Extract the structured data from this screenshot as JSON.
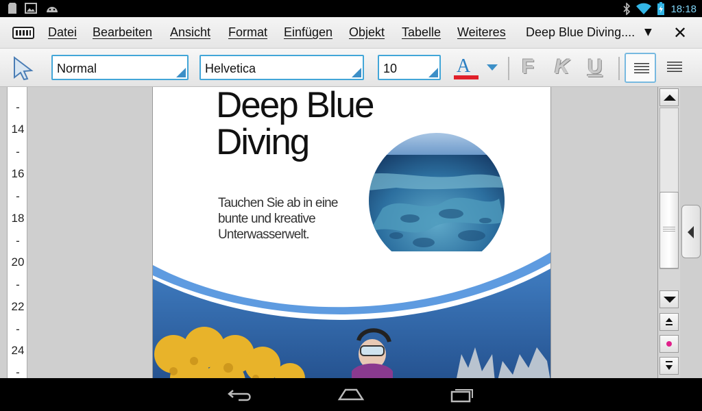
{
  "status_bar": {
    "clock": "18:18",
    "left_icons": [
      "sd-card-icon",
      "image-icon",
      "android-icon"
    ],
    "right_icons": [
      "bluetooth-icon",
      "wifi-icon",
      "battery-charging-icon"
    ]
  },
  "menu_bar": {
    "items": [
      "Datei",
      "Bearbeiten",
      "Ansicht",
      "Format",
      "Einfügen",
      "Objekt",
      "Tabelle",
      "Weiteres"
    ],
    "document_title": "Deep Blue Diving....",
    "caret": "▼",
    "close": "✕"
  },
  "toolbar": {
    "style_value": "Normal",
    "font_value": "Helvetica",
    "size_value": "10",
    "font_color": "#e0202a",
    "font_color_letter": "A",
    "bold_label": "F",
    "italic_label": "K",
    "underline_label": "U",
    "alignments": [
      "align-left",
      "align-right"
    ],
    "active_alignment": "align-left"
  },
  "ruler": {
    "ticks": [
      "-",
      "14",
      "-",
      "16",
      "-",
      "18",
      "-",
      "20",
      "-",
      "22",
      "-",
      "24",
      "-"
    ]
  },
  "document": {
    "headline_line1": "Deep Blue",
    "headline_line2": "Diving",
    "tagline_line1": "Tauchen Sie ab in eine",
    "tagline_line2": "bunte und kreative",
    "tagline_line3": "Unterwasserwelt."
  },
  "colors": {
    "accent": "#42a6d8",
    "ocean_blue": "#2f6fae",
    "coral_yellow": "#e8b32a"
  }
}
